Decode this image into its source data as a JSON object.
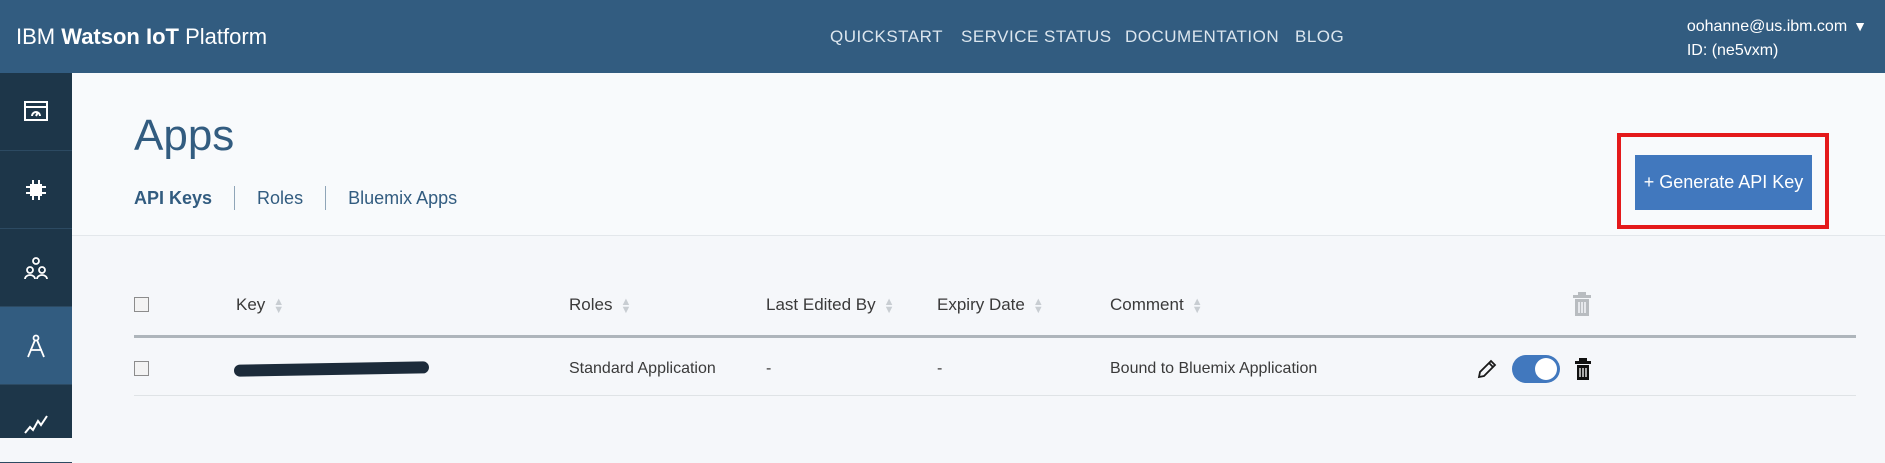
{
  "header": {
    "brand_prefix": "IBM",
    "brand_bold": "Watson IoT",
    "brand_suffix": "Platform",
    "nav": [
      "QUICKSTART",
      "SERVICE STATUS",
      "DOCUMENTATION",
      "BLOG"
    ],
    "user_email": "oohanne@us.ibm.com",
    "user_id": "ID: (ne5vxm)"
  },
  "sidebar": {
    "items": [
      {
        "icon": "dashboard-icon"
      },
      {
        "icon": "devices-chip-icon"
      },
      {
        "icon": "members-icon"
      },
      {
        "icon": "apps-compass-icon",
        "active": true
      },
      {
        "icon": "usage-chart-icon"
      }
    ]
  },
  "page": {
    "title": "Apps",
    "tabs": [
      "API Keys",
      "Roles",
      "Bluemix Apps"
    ],
    "generate_button": "+ Generate API Key"
  },
  "table": {
    "columns": [
      "Key",
      "Roles",
      "Last Edited By",
      "Expiry Date",
      "Comment"
    ],
    "rows": [
      {
        "key": "",
        "roles": "Standard Application",
        "last_edited_by": "-",
        "expiry_date": "-",
        "comment": "Bound to Bluemix Application",
        "enabled": true
      }
    ]
  },
  "colors": {
    "topbar": "#325c80",
    "sidebar": "#1d3649",
    "accent": "#4178be",
    "highlight": "#e4191b"
  }
}
